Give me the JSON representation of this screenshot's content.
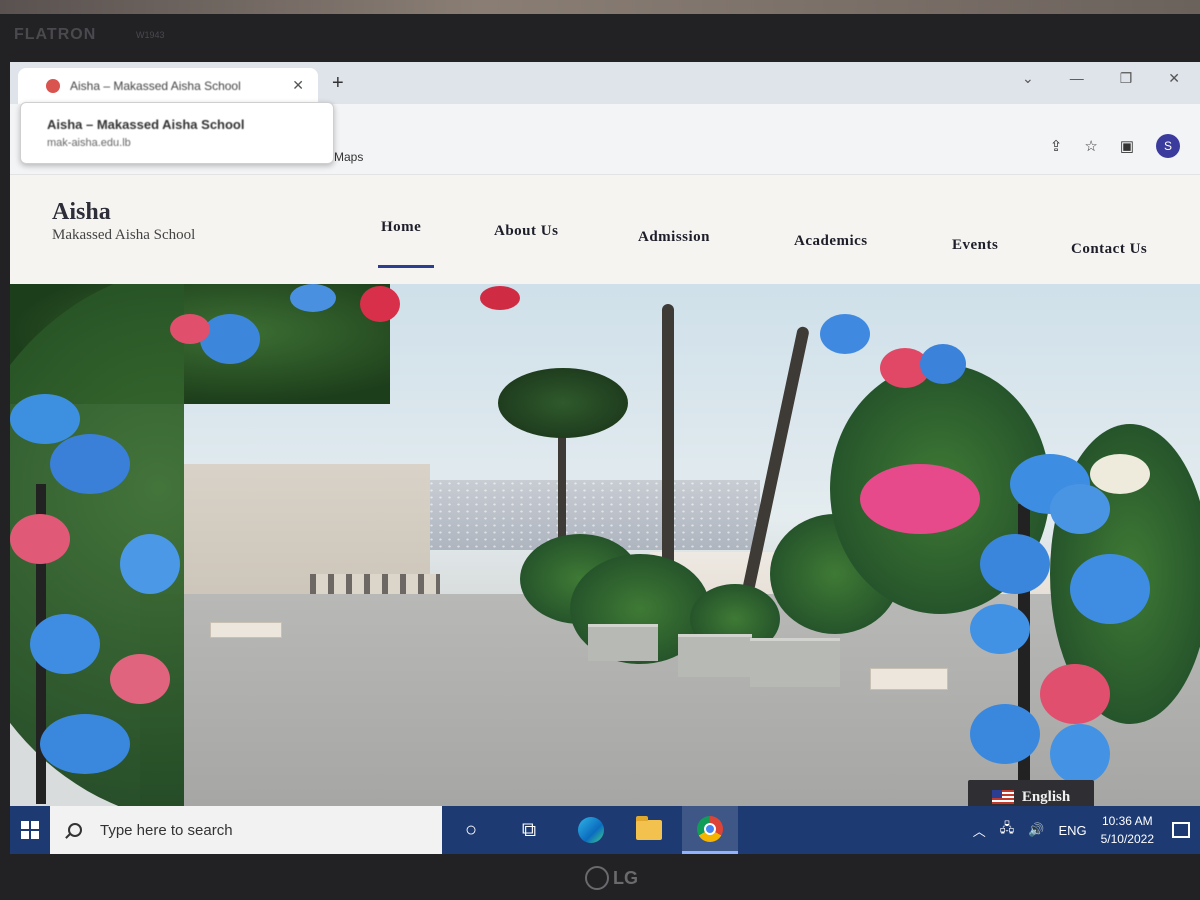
{
  "monitor": {
    "brand": "FLATRON",
    "model": "W1943",
    "logo": "LG"
  },
  "browser": {
    "tab_title": "Aisha – Makassed Aisha School",
    "tab_hover": {
      "title": "Aisha – Makassed Aisha School",
      "url": "mak-aisha.edu.lb"
    },
    "new_tab": "+",
    "bookmark": "Maps",
    "avatar_initial": "S"
  },
  "site": {
    "logo_title": "Aisha",
    "logo_subtitle": "Makassed Aisha School",
    "nav": [
      "Home",
      "About Us",
      "Admission",
      "Academics",
      "Events",
      "Contact Us"
    ],
    "active_nav": "Home",
    "language_button": "English"
  },
  "taskbar": {
    "search_placeholder": "Type here to search",
    "language": "ENG",
    "time": "10:36 AM",
    "date": "5/10/2022"
  },
  "colors": {
    "nav_underline": "#2c3e8f",
    "taskbar": "#1d3a73",
    "lang_button_bg": "#2f2f33"
  }
}
